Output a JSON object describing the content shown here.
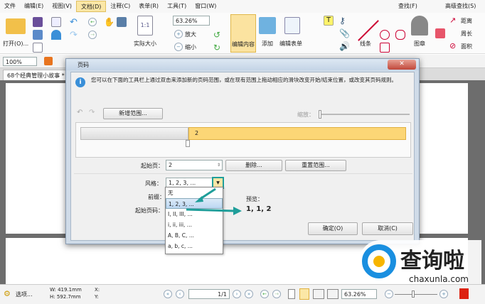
{
  "menu": [
    "文件",
    "编辑(E)",
    "视图(V)",
    "文档(D)",
    "注释(C)",
    "表单(R)",
    "工具(T)",
    "窗口(W)"
  ],
  "ribbon": {
    "open": "打开(O)...",
    "actual_size": "实际大小",
    "zoom_value": "63.26%",
    "zoom_in": "放大",
    "zoom_out": "缩小",
    "edit_content": "编辑内容",
    "add": "添加",
    "edit_form": "编辑表单",
    "lines": "线条",
    "stamp": "图章",
    "distance": "距离",
    "perimeter": "周长",
    "area": "面积",
    "find": "查找(F)",
    "advanced_find": "高级查找(S)"
  },
  "toolbar2": {
    "zoom": "100%"
  },
  "tab": {
    "doc_name": "68个经典管理小故事 *"
  },
  "dialog": {
    "title": "页码",
    "info": "您可以在下面的工具栏上通过双击来添加新的页码范围，或在现有范围上拖动相应的滑块改变开始/结束位置，或改变其页码规则。",
    "new_range": "新增范围...",
    "zoom_label": "缩放：",
    "range_label": "2",
    "start_page_label": "起始页：",
    "start_page_value": "2",
    "delete": "删除...",
    "reset_range": "重置范围...",
    "style_label": "风格：",
    "style_value": "1, 2, 3, ...",
    "style_options": [
      "无",
      "1, 2, 3, ...",
      "I, II, III, ...",
      "i, ii, iii, ...",
      "A, B, C, ...",
      "a, b, c, ..."
    ],
    "prefix_label": "前缀：",
    "start_number_label": "起始页码：",
    "preview_label": "预览：",
    "preview_value": "1, 1, 2",
    "ok": "确定(O)",
    "cancel": "取消(C)"
  },
  "status": {
    "options": "选项...",
    "width": "W: 419.1mm",
    "height": "H: 592.7mm",
    "x": "X:",
    "y": "Y:",
    "page": "1",
    "page_total": "/1",
    "zoom": "63.26%"
  },
  "watermark": {
    "brand": "查询啦",
    "url": "chaxunla.com"
  },
  "colors": {
    "accent_teal": "#1f9e9a",
    "range_yellow": "#fcd676",
    "highlight": "#fbe7a6"
  }
}
